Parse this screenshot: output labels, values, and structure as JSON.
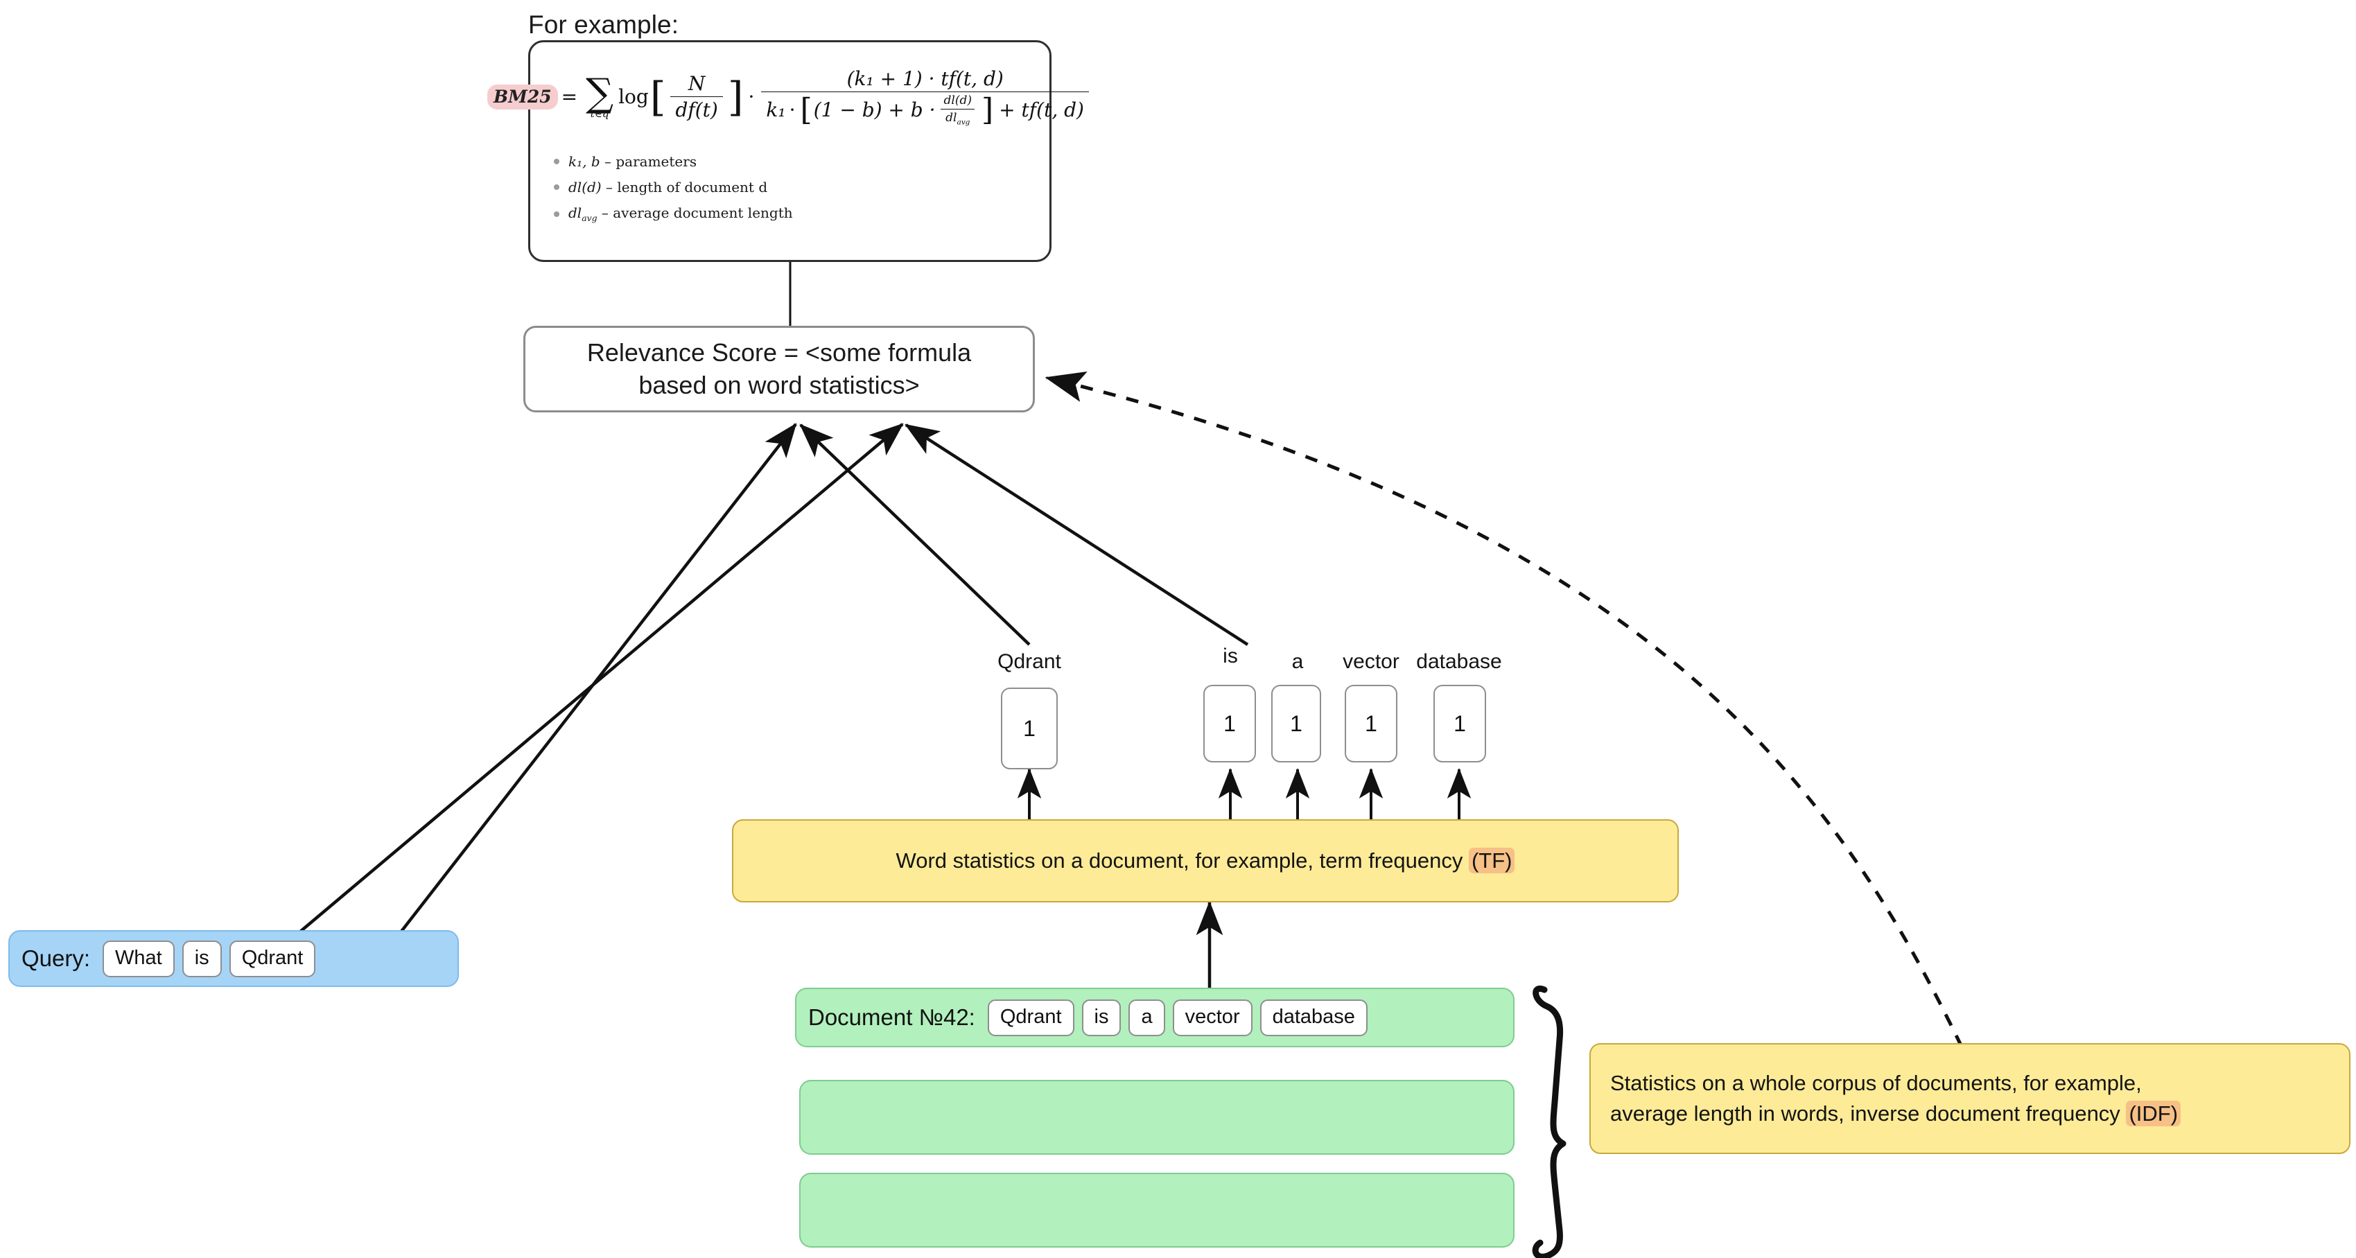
{
  "caption": "For example:",
  "formula": {
    "label": "BM25",
    "equals": "=",
    "sum_sub": "t∈q",
    "log": "log",
    "num_N": "N",
    "den_df": "df(t)",
    "dot": "·",
    "top_right": "(k₁ + 1) · tf(t, d)",
    "bottom_k1": "k₁",
    "bottom_paren": "(1 − b) + b ·",
    "bottom_frac_num": "dl(d)",
    "bottom_frac_den": "dl",
    "bottom_frac_den_sub": "avg",
    "bottom_tail": "+ tf(t, d)",
    "bullets": [
      {
        "symbol": "k₁, b",
        "dash": "–",
        "text": "parameters"
      },
      {
        "symbol": "dl(d)",
        "dash": "–",
        "text": "length of document d"
      },
      {
        "symbol": "dl",
        "symbol_sub": "avg",
        "dash": "–",
        "text": "average document length"
      }
    ]
  },
  "relevance": {
    "line1": "Relevance Score = <some formula",
    "line2": "based on word statistics>"
  },
  "term_frequencies": [
    {
      "label": "Qdrant",
      "count": "1"
    },
    {
      "label": "is",
      "count": "1"
    },
    {
      "label": "a",
      "count": "1"
    },
    {
      "label": "vector",
      "count": "1"
    },
    {
      "label": "database",
      "count": "1"
    }
  ],
  "tf_box": {
    "text": "Word statistics on a document, for example, term frequency ",
    "highlight": "(TF)"
  },
  "idf_box": {
    "line1": "Statistics on a whole corpus of documents, for example,",
    "line2": "average length in words, inverse document frequency ",
    "highlight": "(IDF)"
  },
  "query": {
    "label": "Query:",
    "tokens": [
      "What",
      "is",
      "Qdrant"
    ]
  },
  "document": {
    "label": "Document №42:",
    "tokens": [
      "Qdrant",
      "is",
      "a",
      "vector",
      "database"
    ]
  },
  "colors": {
    "query_bg": "#a5d4f7",
    "document_bg": "#b2f0bd",
    "stat_bg": "#fdeb97",
    "highlight_pink": "#f6cdce",
    "highlight_orange": "#f6c086",
    "edge": "#111111"
  }
}
